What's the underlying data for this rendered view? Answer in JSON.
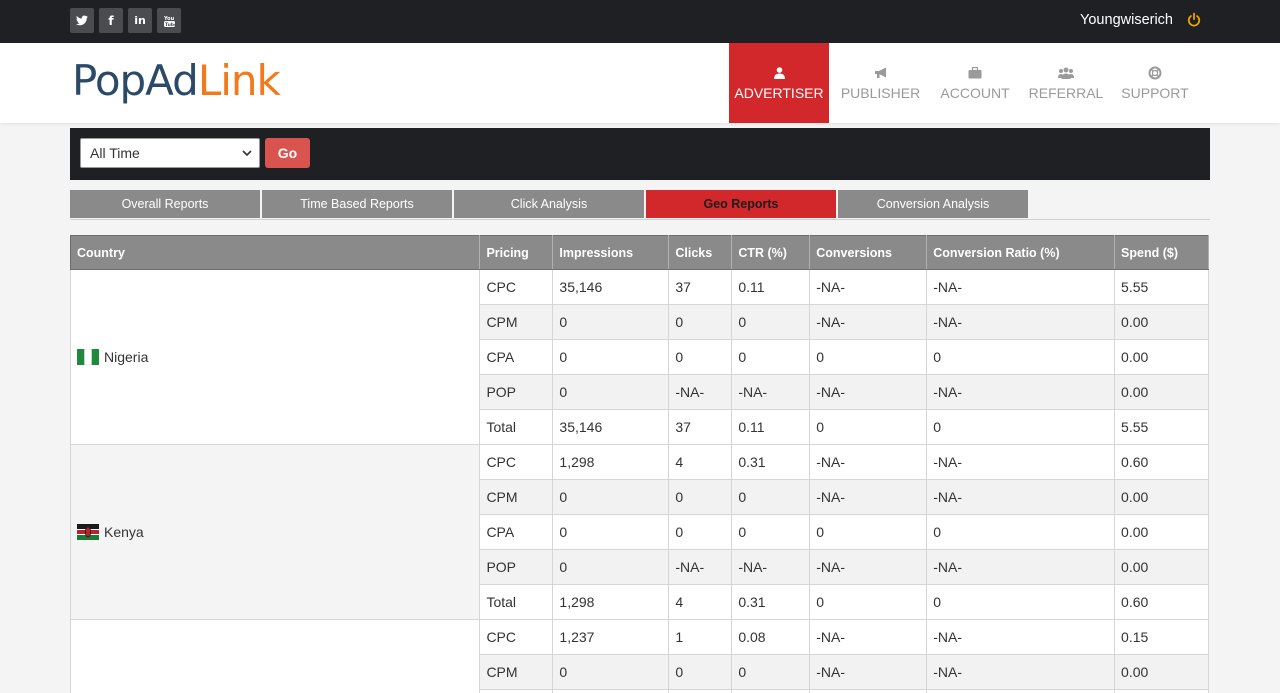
{
  "topbar": {
    "social": [
      {
        "icon": "twitter-icon",
        "glyph": "🐦"
      },
      {
        "icon": "facebook-icon",
        "glyph": "f"
      },
      {
        "icon": "linkedin-icon",
        "glyph": "in"
      },
      {
        "icon": "youtube-icon",
        "glyph": "▶"
      }
    ],
    "username": "Youngwiserich",
    "accent": "#f0a500"
  },
  "logo": {
    "part1": "PopAd",
    "part2": "Link"
  },
  "nav": {
    "advertiser": "ADVERTISER",
    "publisher": "PUBLISHER",
    "account": "ACCOUNT",
    "referral": "REFERRAL",
    "support": "SUPPORT"
  },
  "filter": {
    "selected": "All Time",
    "go": "Go"
  },
  "tabs": [
    "Overall Reports",
    "Time Based Reports",
    "Click Analysis",
    "Geo Reports",
    "Conversion Analysis"
  ],
  "table": {
    "headers": [
      "Country",
      "Pricing",
      "Impressions",
      "Clicks",
      "CTR (%)",
      "Conversions",
      "Conversion Ratio (%)",
      "Spend ($)"
    ],
    "groups": [
      {
        "country": "Nigeria",
        "rows": [
          [
            "CPC",
            "35,146",
            "37",
            "0.11",
            "-NA-",
            "-NA-",
            "5.55"
          ],
          [
            "CPM",
            "0",
            "0",
            "0",
            "-NA-",
            "-NA-",
            "0.00"
          ],
          [
            "CPA",
            "0",
            "0",
            "0",
            "0",
            "0",
            "0.00"
          ],
          [
            "POP",
            "0",
            "-NA-",
            "-NA-",
            "-NA-",
            "-NA-",
            "0.00"
          ],
          [
            "Total",
            "35,146",
            "37",
            "0.11",
            "0",
            "0",
            "5.55"
          ]
        ]
      },
      {
        "country": "Kenya",
        "rows": [
          [
            "CPC",
            "1,298",
            "4",
            "0.31",
            "-NA-",
            "-NA-",
            "0.60"
          ],
          [
            "CPM",
            "0",
            "0",
            "0",
            "-NA-",
            "-NA-",
            "0.00"
          ],
          [
            "CPA",
            "0",
            "0",
            "0",
            "0",
            "0",
            "0.00"
          ],
          [
            "POP",
            "0",
            "-NA-",
            "-NA-",
            "-NA-",
            "-NA-",
            "0.00"
          ],
          [
            "Total",
            "1,298",
            "4",
            "0.31",
            "0",
            "0",
            "0.60"
          ]
        ]
      },
      {
        "country": "",
        "rows": [
          [
            "CPC",
            "1,237",
            "1",
            "0.08",
            "-NA-",
            "-NA-",
            "0.15"
          ],
          [
            "CPM",
            "0",
            "0",
            "0",
            "-NA-",
            "-NA-",
            "0.00"
          ],
          [
            "",
            "",
            "",
            "",
            "",
            "",
            ""
          ]
        ]
      }
    ]
  }
}
